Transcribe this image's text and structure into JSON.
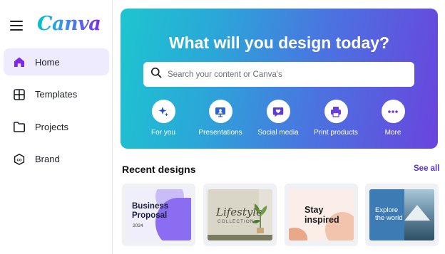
{
  "app": {
    "logo_text": "Canva"
  },
  "sidebar": {
    "items": [
      {
        "label": "Home",
        "icon": "home-icon",
        "active": true
      },
      {
        "label": "Templates",
        "icon": "templates-icon"
      },
      {
        "label": "Projects",
        "icon": "folder-icon"
      },
      {
        "label": "Brand",
        "icon": "brand-icon"
      }
    ]
  },
  "hero": {
    "title": "What will you design today?",
    "search_placeholder": "Search your content or Canva's",
    "actions": [
      {
        "label": "For you",
        "icon": "sparkle-icon"
      },
      {
        "label": "Presentations",
        "icon": "presentation-icon"
      },
      {
        "label": "Social media",
        "icon": "heart-chat-icon"
      },
      {
        "label": "Print products",
        "icon": "printer-icon"
      },
      {
        "label": "More",
        "icon": "more-icon"
      }
    ]
  },
  "recent": {
    "title": "Recent designs",
    "see_all": "See all",
    "designs": [
      {
        "title_line1": "Business",
        "title_line2": "Proposal",
        "subtitle": "2024"
      },
      {
        "title_line1": "Lifestyle",
        "subtitle": "COLLECTION"
      },
      {
        "title_line1": "Stay",
        "title_line2": "inspired"
      },
      {
        "title_line1": "Explore",
        "title_line2": "the world"
      }
    ]
  },
  "colors": {
    "accent": "#7d2ae8",
    "active_nav_bg": "#eeebff",
    "see_all": "#5a32d6",
    "hero_gradient_start": "#1dc5cf",
    "hero_gradient_end": "#6a44de"
  }
}
